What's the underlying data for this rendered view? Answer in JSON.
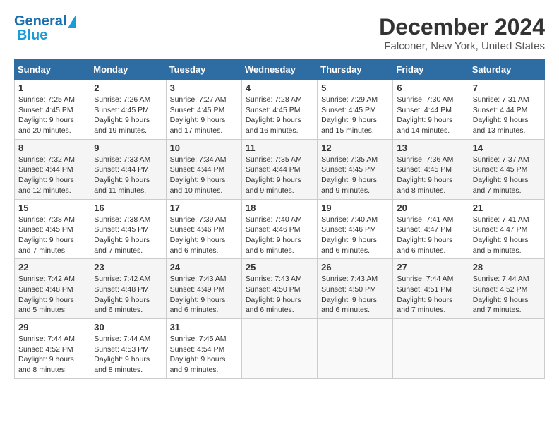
{
  "header": {
    "logo_general": "General",
    "logo_blue": "Blue",
    "main_title": "December 2024",
    "subtitle": "Falconer, New York, United States"
  },
  "calendar": {
    "days_of_week": [
      "Sunday",
      "Monday",
      "Tuesday",
      "Wednesday",
      "Thursday",
      "Friday",
      "Saturday"
    ],
    "weeks": [
      [
        {
          "day": "1",
          "sunrise": "7:25 AM",
          "sunset": "4:45 PM",
          "daylight": "9 hours and 20 minutes."
        },
        {
          "day": "2",
          "sunrise": "7:26 AM",
          "sunset": "4:45 PM",
          "daylight": "9 hours and 19 minutes."
        },
        {
          "day": "3",
          "sunrise": "7:27 AM",
          "sunset": "4:45 PM",
          "daylight": "9 hours and 17 minutes."
        },
        {
          "day": "4",
          "sunrise": "7:28 AM",
          "sunset": "4:45 PM",
          "daylight": "9 hours and 16 minutes."
        },
        {
          "day": "5",
          "sunrise": "7:29 AM",
          "sunset": "4:45 PM",
          "daylight": "9 hours and 15 minutes."
        },
        {
          "day": "6",
          "sunrise": "7:30 AM",
          "sunset": "4:44 PM",
          "daylight": "9 hours and 14 minutes."
        },
        {
          "day": "7",
          "sunrise": "7:31 AM",
          "sunset": "4:44 PM",
          "daylight": "9 hours and 13 minutes."
        }
      ],
      [
        {
          "day": "8",
          "sunrise": "7:32 AM",
          "sunset": "4:44 PM",
          "daylight": "9 hours and 12 minutes."
        },
        {
          "day": "9",
          "sunrise": "7:33 AM",
          "sunset": "4:44 PM",
          "daylight": "9 hours and 11 minutes."
        },
        {
          "day": "10",
          "sunrise": "7:34 AM",
          "sunset": "4:44 PM",
          "daylight": "9 hours and 10 minutes."
        },
        {
          "day": "11",
          "sunrise": "7:35 AM",
          "sunset": "4:44 PM",
          "daylight": "9 hours and 9 minutes."
        },
        {
          "day": "12",
          "sunrise": "7:35 AM",
          "sunset": "4:45 PM",
          "daylight": "9 hours and 9 minutes."
        },
        {
          "day": "13",
          "sunrise": "7:36 AM",
          "sunset": "4:45 PM",
          "daylight": "9 hours and 8 minutes."
        },
        {
          "day": "14",
          "sunrise": "7:37 AM",
          "sunset": "4:45 PM",
          "daylight": "9 hours and 7 minutes."
        }
      ],
      [
        {
          "day": "15",
          "sunrise": "7:38 AM",
          "sunset": "4:45 PM",
          "daylight": "9 hours and 7 minutes."
        },
        {
          "day": "16",
          "sunrise": "7:38 AM",
          "sunset": "4:45 PM",
          "daylight": "9 hours and 7 minutes."
        },
        {
          "day": "17",
          "sunrise": "7:39 AM",
          "sunset": "4:46 PM",
          "daylight": "9 hours and 6 minutes."
        },
        {
          "day": "18",
          "sunrise": "7:40 AM",
          "sunset": "4:46 PM",
          "daylight": "9 hours and 6 minutes."
        },
        {
          "day": "19",
          "sunrise": "7:40 AM",
          "sunset": "4:46 PM",
          "daylight": "9 hours and 6 minutes."
        },
        {
          "day": "20",
          "sunrise": "7:41 AM",
          "sunset": "4:47 PM",
          "daylight": "9 hours and 6 minutes."
        },
        {
          "day": "21",
          "sunrise": "7:41 AM",
          "sunset": "4:47 PM",
          "daylight": "9 hours and 5 minutes."
        }
      ],
      [
        {
          "day": "22",
          "sunrise": "7:42 AM",
          "sunset": "4:48 PM",
          "daylight": "9 hours and 5 minutes."
        },
        {
          "day": "23",
          "sunrise": "7:42 AM",
          "sunset": "4:48 PM",
          "daylight": "9 hours and 6 minutes."
        },
        {
          "day": "24",
          "sunrise": "7:43 AM",
          "sunset": "4:49 PM",
          "daylight": "9 hours and 6 minutes."
        },
        {
          "day": "25",
          "sunrise": "7:43 AM",
          "sunset": "4:50 PM",
          "daylight": "9 hours and 6 minutes."
        },
        {
          "day": "26",
          "sunrise": "7:43 AM",
          "sunset": "4:50 PM",
          "daylight": "9 hours and 6 minutes."
        },
        {
          "day": "27",
          "sunrise": "7:44 AM",
          "sunset": "4:51 PM",
          "daylight": "9 hours and 7 minutes."
        },
        {
          "day": "28",
          "sunrise": "7:44 AM",
          "sunset": "4:52 PM",
          "daylight": "9 hours and 7 minutes."
        }
      ],
      [
        {
          "day": "29",
          "sunrise": "7:44 AM",
          "sunset": "4:52 PM",
          "daylight": "9 hours and 8 minutes."
        },
        {
          "day": "30",
          "sunrise": "7:44 AM",
          "sunset": "4:53 PM",
          "daylight": "9 hours and 8 minutes."
        },
        {
          "day": "31",
          "sunrise": "7:45 AM",
          "sunset": "4:54 PM",
          "daylight": "9 hours and 9 minutes."
        },
        null,
        null,
        null,
        null
      ]
    ]
  }
}
